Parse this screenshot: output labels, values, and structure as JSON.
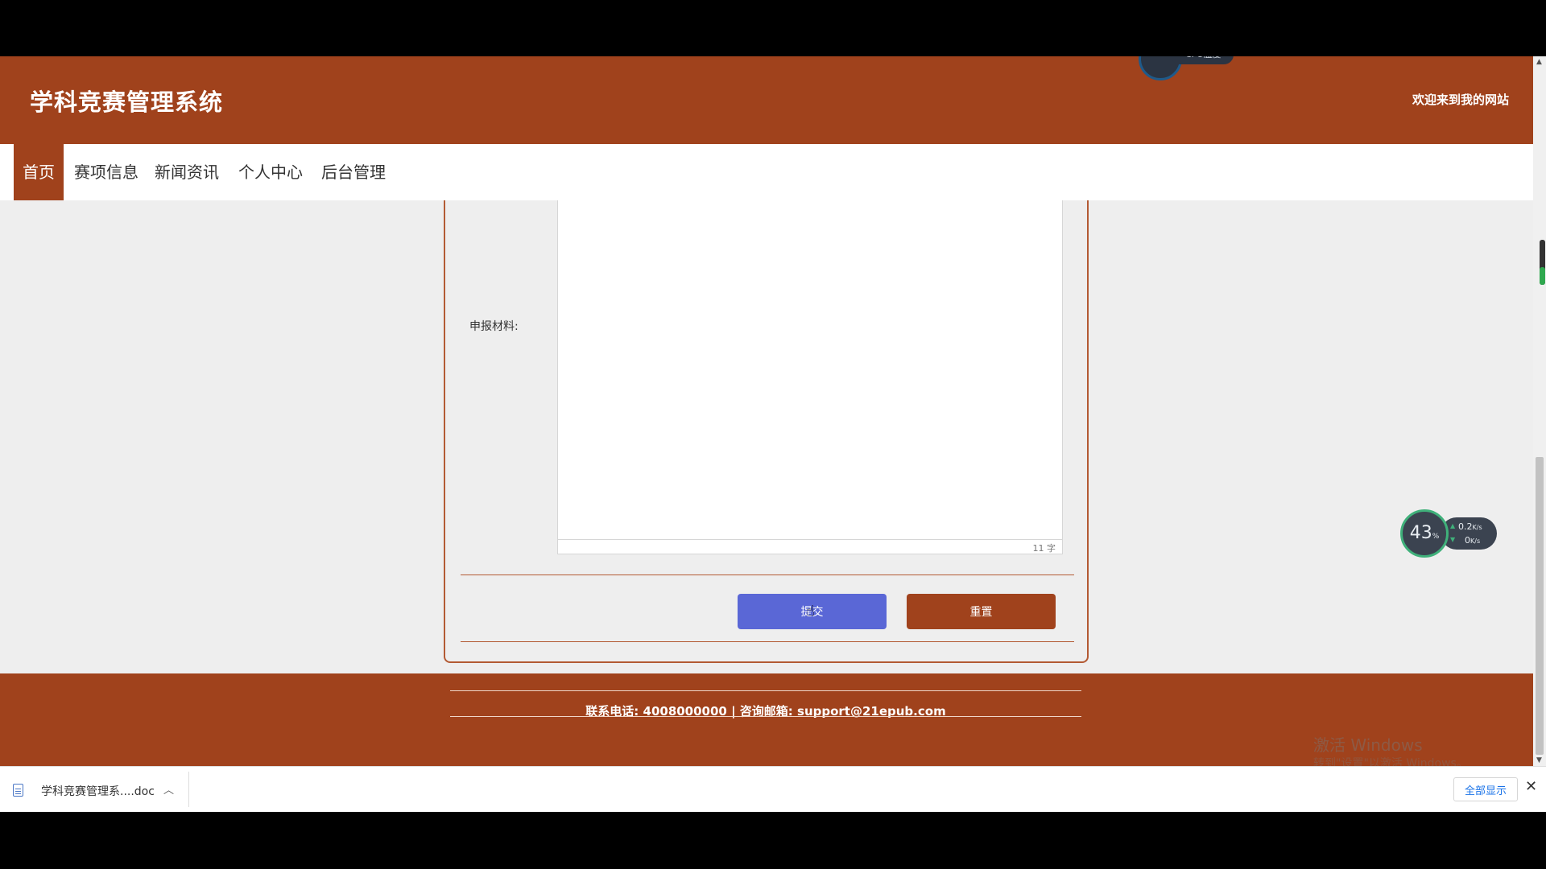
{
  "header": {
    "site_title": "学科竞赛管理系统",
    "welcome": "欢迎来到我的网站",
    "cpu_widget_label": "CPU温度"
  },
  "nav": {
    "items": [
      {
        "label": "首页",
        "active": true
      },
      {
        "label": "赛项信息"
      },
      {
        "label": "新闻资讯"
      },
      {
        "label": "个人中心"
      },
      {
        "label": "后台管理"
      }
    ]
  },
  "form": {
    "material_label": "申报材料:",
    "word_count": "11 字",
    "submit_label": "提交",
    "reset_label": "重置"
  },
  "footer": {
    "contact": "联系电话: 4008000000 | 咨询邮箱: support@21epub.com"
  },
  "net_widget": {
    "cpu_percent": "43",
    "percent_unit": "%",
    "upload_value": "0.2",
    "upload_unit": "K/s",
    "download_value": "0",
    "download_unit": "K/s"
  },
  "watermark": {
    "line1": "激活 Windows",
    "line2": "转到\"设置\"以激活 Windows。"
  },
  "download_bar": {
    "file_name": "学科竞赛管理系....doc",
    "show_all_label": "全部显示"
  },
  "colors": {
    "brand": "#a0421c",
    "submit_button": "#5a67d6"
  }
}
